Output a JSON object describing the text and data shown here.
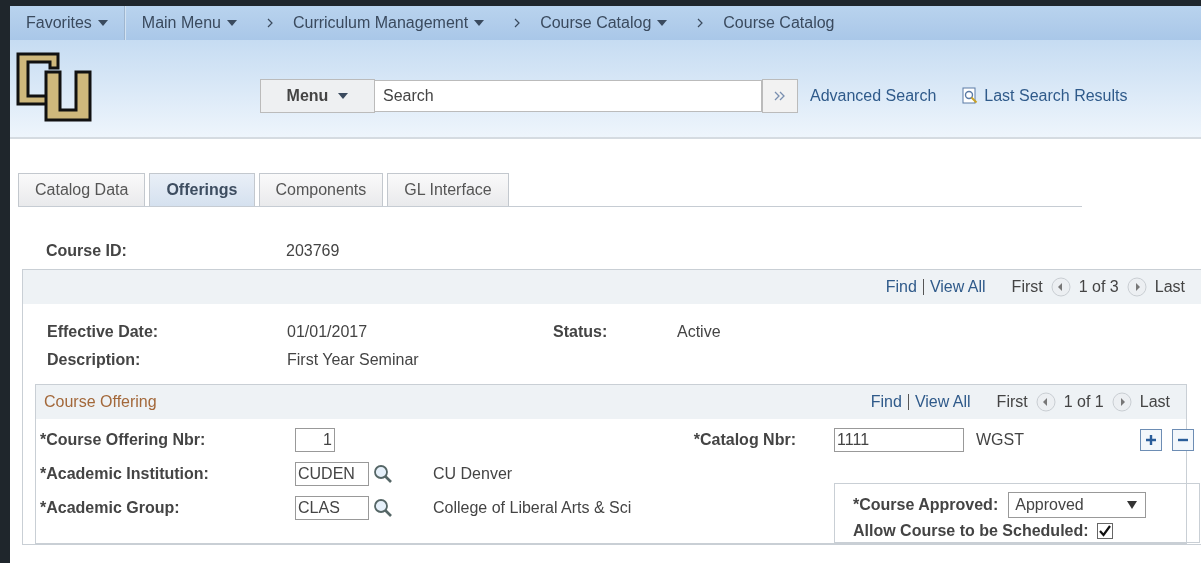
{
  "nav": {
    "items": [
      {
        "label": "Favorites",
        "dropdown": true
      },
      {
        "label": "Main Menu",
        "dropdown": true
      }
    ],
    "breadcrumbs": [
      {
        "label": "Curriculum Management",
        "dropdown": true
      },
      {
        "label": "Course Catalog",
        "dropdown": true
      },
      {
        "label": "Course Catalog",
        "dropdown": false
      }
    ]
  },
  "search_bar": {
    "menu_label": "Menu",
    "placeholder": "Search",
    "links": [
      {
        "label": "Advanced Search",
        "kind": "plain"
      },
      {
        "label": "Last Search Results",
        "kind": "icon"
      }
    ]
  },
  "tabs": [
    {
      "label": "Catalog Data",
      "selected": false
    },
    {
      "label": "Offerings",
      "selected": true
    },
    {
      "label": "Components",
      "selected": false
    },
    {
      "label": "GL Interface",
      "selected": false
    }
  ],
  "course_id": {
    "label": "Course ID:",
    "value": "203769"
  },
  "effective_panel": {
    "nav": {
      "find": "Find",
      "view_all": "View All",
      "first": "First",
      "position": "1 of 3",
      "last": "Last"
    },
    "effective_date": {
      "label": "Effective Date:",
      "value": "01/01/2017"
    },
    "status": {
      "label": "Status:",
      "value": "Active"
    },
    "description": {
      "label": "Description:",
      "value": "First Year Seminar"
    }
  },
  "offering_panel": {
    "title": "Course Offering",
    "nav": {
      "find": "Find",
      "view_all": "View All",
      "first": "First",
      "position": "1 of 1",
      "last": "Last"
    },
    "fields": [
      {
        "label": "*Course Offering Nbr:",
        "value": "1",
        "lookup": false
      },
      {
        "label": "*Academic Institution:",
        "value": "CUDEN",
        "lookup": true,
        "description": "CU Denver"
      },
      {
        "label": "*Academic Group:",
        "value": "CLAS",
        "lookup": true,
        "description": "College of Liberal Arts & Sci"
      }
    ],
    "catalog": {
      "label": "*Catalog Nbr:",
      "value": "1111",
      "subject": "WGST"
    },
    "approval": {
      "label": "*Course Approved:",
      "value": "Approved"
    },
    "schedule": {
      "label": "Allow Course to be Scheduled:",
      "checked": true
    }
  }
}
